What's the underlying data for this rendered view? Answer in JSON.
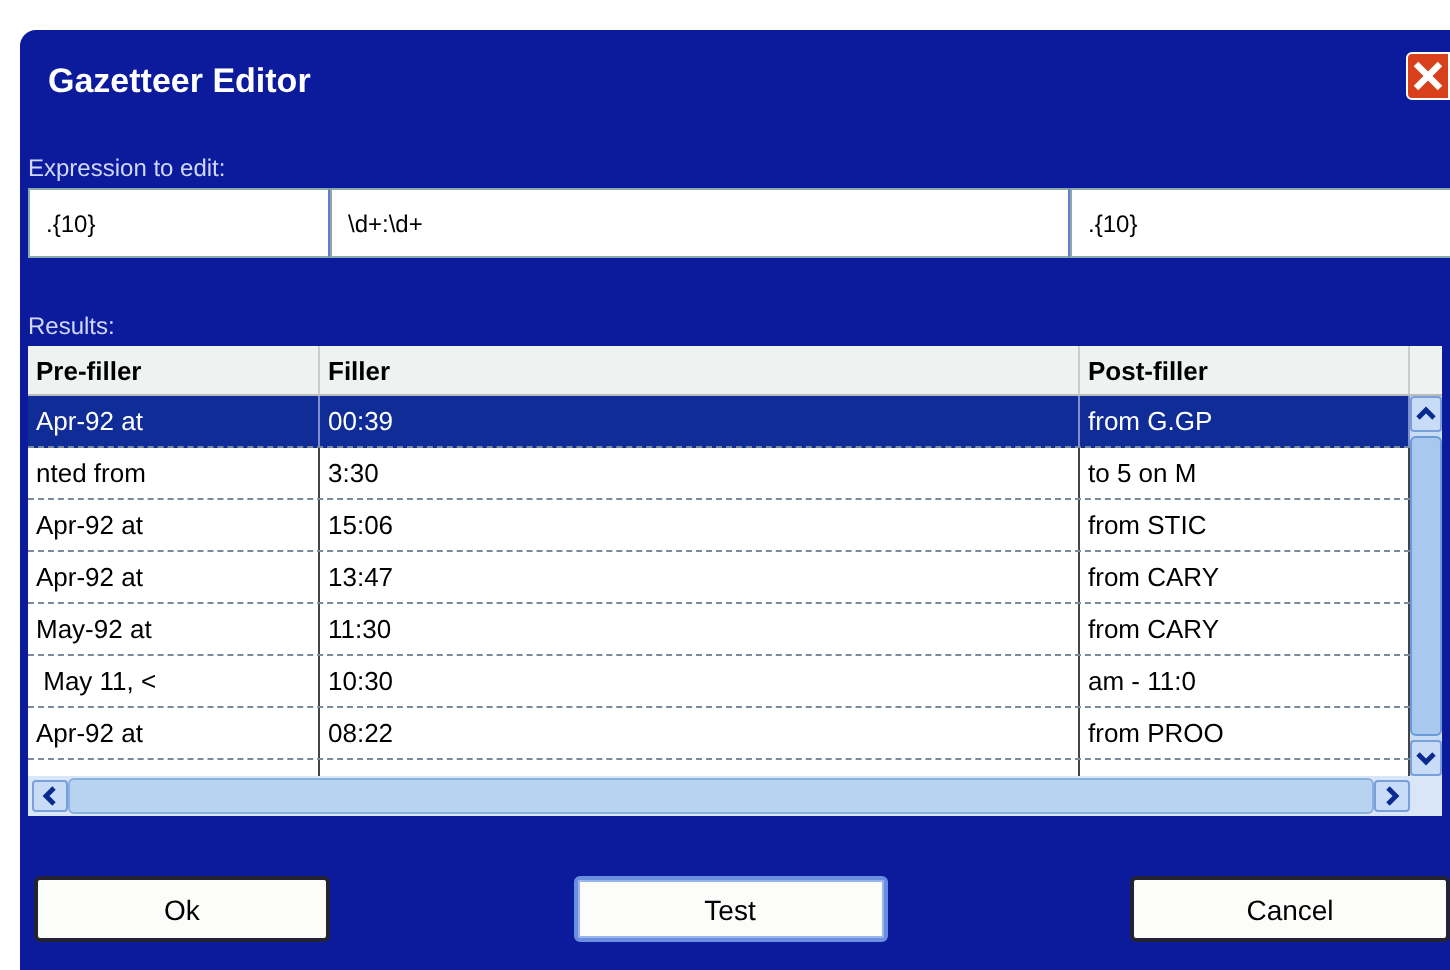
{
  "window": {
    "title": "Gazetteer Editor"
  },
  "expression": {
    "label": "Expression to edit:",
    "fields": [
      ".{10}",
      "\\d+:\\d+",
      ".{10}"
    ]
  },
  "results": {
    "label": "Results:",
    "columns": [
      "Pre-filler",
      "Filler",
      "Post-filler"
    ],
    "rows": [
      {
        "cells": [
          "Apr-92 at",
          "00:39",
          "from G.GP"
        ],
        "selected": true
      },
      {
        "cells": [
          "nted from",
          "3:30",
          "to 5 on M"
        ],
        "selected": false
      },
      {
        "cells": [
          "Apr-92 at",
          "15:06",
          "from STIC"
        ],
        "selected": false
      },
      {
        "cells": [
          "Apr-92 at",
          "13:47",
          "from CARY"
        ],
        "selected": false
      },
      {
        "cells": [
          "May-92 at",
          "11:30",
          "from CARY"
        ],
        "selected": false
      },
      {
        "cells": [
          " May 11, <",
          "10:30",
          "am - 11:0"
        ],
        "selected": false
      },
      {
        "cells": [
          "Apr-92 at",
          "08:22",
          "from PROO"
        ],
        "selected": false
      }
    ]
  },
  "buttons": [
    {
      "label": "Ok",
      "selected": false
    },
    {
      "label": "Test",
      "selected": true
    },
    {
      "label": "Cancel",
      "selected": false
    }
  ]
}
